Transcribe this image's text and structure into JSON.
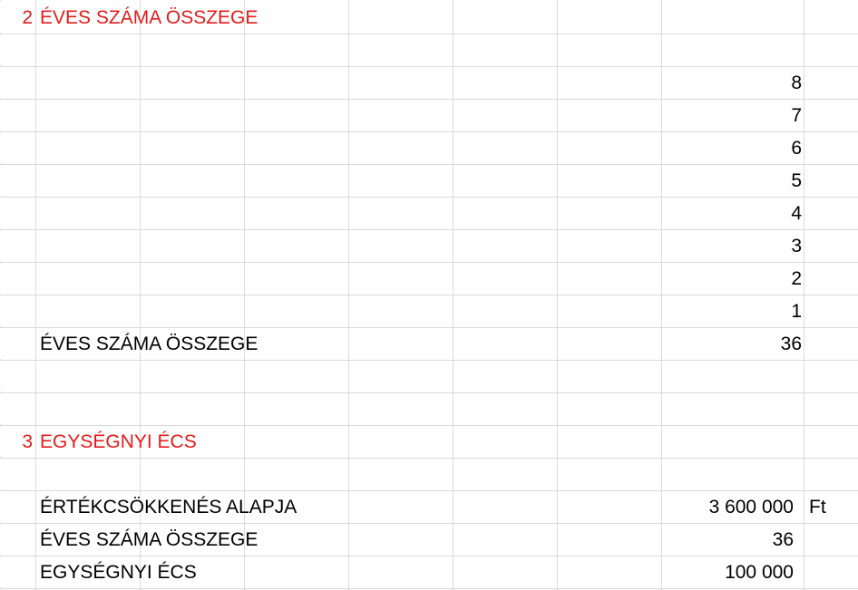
{
  "colors": {
    "heading": "#e21b1b",
    "text": "#000000",
    "gridline": "#dadada"
  },
  "sections": {
    "s2": {
      "number": "2",
      "title": "ÉVES SZÁMA ÖSSZEGE",
      "values": [
        "8",
        "7",
        "6",
        "5",
        "4",
        "3",
        "2",
        "1"
      ],
      "total_label": "ÉVES SZÁMA ÖSSZEGE",
      "total_value": "36"
    },
    "s3": {
      "number": "3",
      "title": "EGYSÉGNYI ÉCS",
      "rows": [
        {
          "label": "ÉRTÉKCSÖKKENÉS ALAPJA",
          "value": "3 600 000",
          "unit": "Ft"
        },
        {
          "label": "ÉVES SZÁMA ÖSSZEGE",
          "value": "36",
          "unit": ""
        },
        {
          "label": "EGYSÉGNYI ÉCS",
          "value": "100 000",
          "unit": ""
        }
      ]
    }
  }
}
